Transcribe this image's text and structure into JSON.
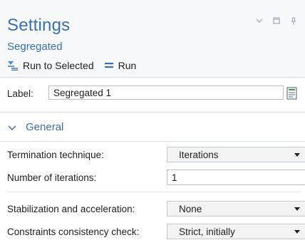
{
  "header": {
    "title": "Settings",
    "subtitle": "Segregated",
    "toolbar": {
      "run_selected_label": "Run to Selected",
      "run_label": "Run"
    },
    "window_controls": [
      "chevron-down-icon",
      "restore-icon",
      "pin-icon"
    ]
  },
  "label_field": {
    "label": "Label:",
    "value": "Segregated 1"
  },
  "general_section": {
    "title": "General",
    "expanded": true,
    "rows": [
      {
        "label": "Termination technique:",
        "control": "select",
        "value": "Iterations"
      },
      {
        "label": "Number of iterations:",
        "control": "input",
        "value": "1"
      },
      {
        "label": "Stabilization and acceleration:",
        "control": "select",
        "value": "None"
      },
      {
        "label": "Constraints consistency check:",
        "control": "select",
        "value": "Strict, initially"
      }
    ]
  },
  "colors": {
    "accent": "#3a6fb0",
    "header_bg": "#f6f8fa"
  }
}
